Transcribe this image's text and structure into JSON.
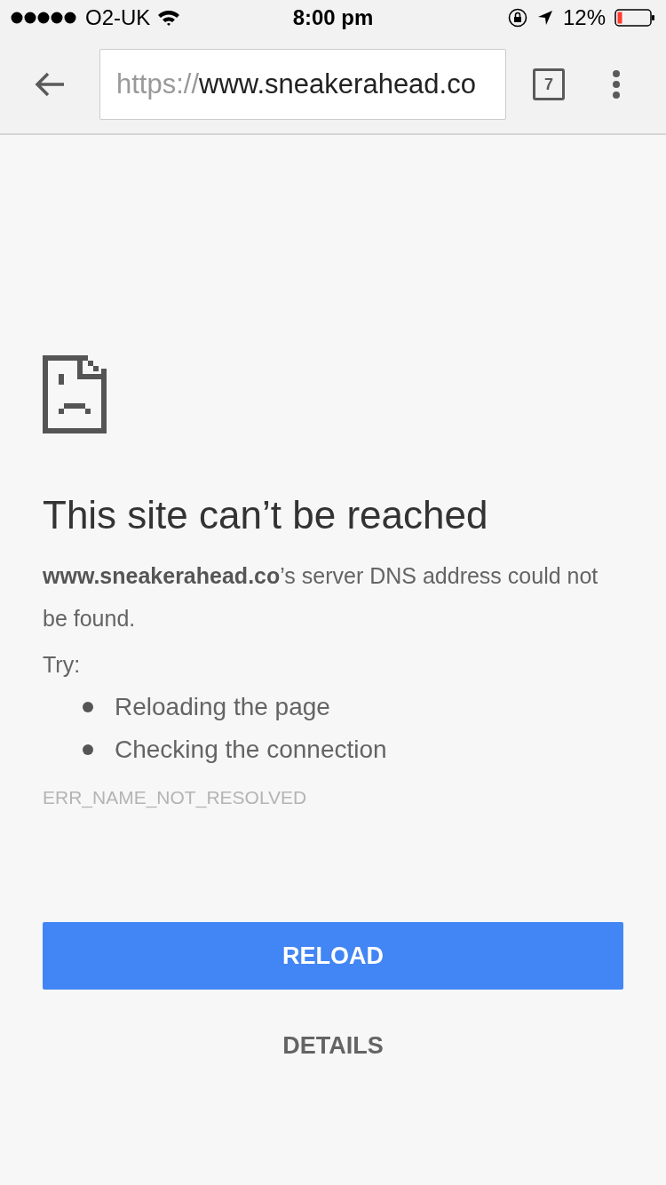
{
  "status_bar": {
    "carrier": "O2-UK",
    "time": "8:00 pm",
    "battery": "12%"
  },
  "toolbar": {
    "url": {
      "scheme": "https://",
      "host": "www.sneakerahead.co"
    },
    "tab_count": "7"
  },
  "error": {
    "title": "This site can’t be reached",
    "message": "**www.sneakerahead.co**’s server DNS address could not be found.",
    "try_label": "Try:",
    "suggestions": [
      "Reloading the page",
      "Checking the connection"
    ],
    "code": "ERR_NAME_NOT_RESOLVED"
  },
  "buttons": [
    {
      "label": "RELOAD",
      "kind": "primary"
    },
    {
      "label": "DETAILS",
      "kind": "text"
    }
  ]
}
